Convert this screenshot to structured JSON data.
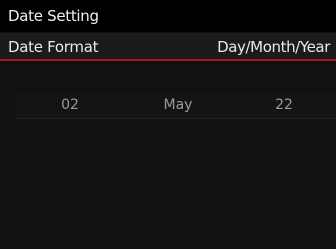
{
  "header": {
    "title": "Date Setting"
  },
  "format": {
    "label": "Date Format",
    "value": "Day/Month/Year"
  },
  "date": {
    "day": "02",
    "month": "May",
    "year": "22"
  },
  "colors": {
    "accent": "#b01020",
    "background": "#111112",
    "header": "#000000"
  }
}
